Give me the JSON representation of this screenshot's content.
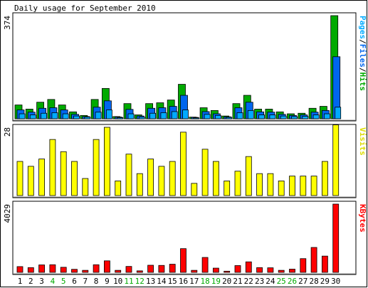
{
  "chart_data": [
    {
      "type": "bar",
      "title": "Daily usage for September 2010",
      "ymax_label": "374",
      "legend": [
        "Pages",
        "Files",
        "Hits"
      ],
      "categories": [
        "1",
        "2",
        "3",
        "4",
        "5",
        "6",
        "7",
        "8",
        "9",
        "10",
        "11",
        "12",
        "13",
        "14",
        "15",
        "16",
        "17",
        "18",
        "19",
        "20",
        "21",
        "22",
        "23",
        "24",
        "25",
        "26",
        "27",
        "28",
        "29",
        "30"
      ],
      "weekend_days": [
        "4",
        "5",
        "11",
        "12",
        "18",
        "19",
        "25",
        "26"
      ],
      "ylim": [
        0,
        374
      ],
      "series": [
        {
          "name": "Hits",
          "color": "#00aa00",
          "values": [
            50,
            35,
            60,
            70,
            50,
            25,
            12,
            70,
            110,
            8,
            55,
            14,
            55,
            58,
            68,
            125,
            6,
            40,
            30,
            10,
            55,
            85,
            35,
            35,
            25,
            18,
            20,
            38,
            45,
            374
          ]
        },
        {
          "name": "Files",
          "color": "#0066ee",
          "values": [
            32,
            24,
            38,
            40,
            32,
            16,
            8,
            42,
            65,
            6,
            34,
            10,
            38,
            40,
            45,
            85,
            5,
            26,
            18,
            7,
            40,
            60,
            25,
            24,
            16,
            12,
            14,
            24,
            30,
            225
          ]
        },
        {
          "name": "Pages",
          "color": "#00aaff",
          "values": [
            18,
            14,
            20,
            22,
            18,
            10,
            6,
            24,
            32,
            4,
            18,
            6,
            20,
            22,
            26,
            32,
            3,
            16,
            12,
            5,
            22,
            30,
            14,
            14,
            10,
            8,
            9,
            14,
            18,
            42
          ]
        }
      ]
    },
    {
      "type": "bar",
      "legend": [
        "Visits"
      ],
      "ymax_label": "28",
      "ylim": [
        0,
        28
      ],
      "series": [
        {
          "name": "Visits",
          "color": "#ffff00",
          "values": [
            14,
            12,
            15,
            23,
            18,
            14,
            7,
            23,
            28,
            6,
            17,
            9,
            15,
            12,
            14,
            26,
            5,
            19,
            14,
            6,
            10,
            16,
            9,
            9,
            6,
            8,
            8,
            8,
            14,
            29
          ]
        }
      ]
    },
    {
      "type": "bar",
      "legend": [
        "KBytes"
      ],
      "ymax_label": "4029",
      "ylim": [
        0,
        4029
      ],
      "series": [
        {
          "name": "KBytes",
          "color": "#ff0000",
          "values": [
            340,
            280,
            440,
            450,
            300,
            180,
            120,
            450,
            680,
            120,
            350,
            90,
            420,
            410,
            480,
            1400,
            120,
            880,
            250,
            70,
            400,
            620,
            280,
            270,
            120,
            190,
            810,
            1470,
            960,
            4029
          ]
        }
      ]
    }
  ]
}
